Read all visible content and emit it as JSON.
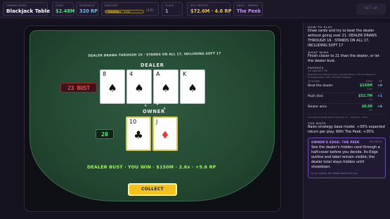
{
  "topbar": {
    "title": {
      "label": "OWNER MODE",
      "value": "Blackjack Table"
    },
    "cash": {
      "label": "CASH",
      "value": "$2.48M"
    },
    "research": {
      "label": "RESEARCH",
      "value": "320 RP"
    },
    "mastery": {
      "label": "MASTERY",
      "rank": "Unranked · +0%",
      "count": "(1/1)",
      "progress": 0.35
    },
    "plays": {
      "label": "PLAYS",
      "value": "1"
    },
    "avg_payout": {
      "label": "AVG PAYOUT",
      "value": "$72.6M · 4.6 RP"
    },
    "edge": {
      "label": "EDGE · ARMED",
      "value": "The Peek"
    },
    "setup_button": "SET UP"
  },
  "table": {
    "rule_text": "DEALER DRAWS THROUGH 16 · STANDS ON ALL 17, INCLUDING SOFT 17",
    "dealer_label": "DEALER",
    "owner_label": "OWNER",
    "dealer_score": "23 BUST",
    "player_score": "20",
    "dealer_cards": [
      {
        "rank": "8",
        "suit": "♠"
      },
      {
        "rank": "4",
        "suit": "♠"
      },
      {
        "rank": "A",
        "suit": "♠"
      },
      {
        "rank": "K",
        "suit": "♠"
      }
    ],
    "player_cards": [
      {
        "rank": "10",
        "suit": "♣"
      },
      {
        "rank": "J",
        "suit": "♦"
      }
    ],
    "result": "DEALER BUST · YOU WIN · $150M · 2.6x · +9.6 RP",
    "collect_button": "COLLECT"
  },
  "panel": {
    "how_title": "HOW TO PLAY",
    "how_text": "Draw cards and try to beat the dealer without going over 21. DEALER DRAWS THROUGH 16 · STANDS ON ALL 17, INCLUDING SOFT 17",
    "wins_title": "WHAT WINS",
    "wins_text": "Finish closer to 21 than the dealer, or let the dealer bust.",
    "payouts_title": "PAYOUTS",
    "payouts_note": "1× cash $57.7M",
    "payouts_sub": "Base RP is boosted for every unlocked Edge (+35%) & Research Complete adds +30% more RP multiplier",
    "col_outcome": "OUTCOME",
    "col_cash": "CASH",
    "col_rp": "RP",
    "rows": [
      {
        "outcome": "Beat the dealer",
        "cash": "$150M",
        "rate": "2.6×",
        "rp": "+9"
      },
      {
        "outcome": "Push (tie)",
        "cash": "$53.7M",
        "rate": "1×",
        "rp": "+1"
      },
      {
        "outcome": "Dealer wins",
        "cash": "$0.00",
        "rate": "0×",
        "rp": "+0"
      }
    ],
    "footnote": "Live table includes Grand Opening 3× · Collectors +30%",
    "math_title": "THE MATH",
    "math_text": "Basic-strategy base model. +30% expected return per play. With The Peek: +35%",
    "edge_title": "OWNER'S EDGE: THE PEEK",
    "edge_tag": "ON DECK",
    "edge_text": "See the dealer's hidden card through a half-cover before you decide. Its Edge outline and label remain visible; the dealer total stays hidden until showdown.",
    "edge_footer": "In our casino, the dealer works for you."
  }
}
